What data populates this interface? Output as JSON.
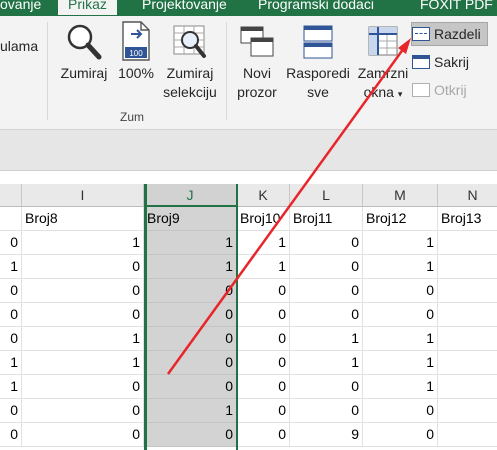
{
  "ribbon": {
    "tabs": [
      {
        "label": "ovanje",
        "active": false
      },
      {
        "label": "Prikaz",
        "active": true
      },
      {
        "label": "Projektovanje",
        "active": false
      },
      {
        "label": "Programski dodaci",
        "active": false
      },
      {
        "label": "FOXIT PDF",
        "active": false
      }
    ],
    "left_partial_label": "ulama",
    "zoom_label": "Zumiraj",
    "zoom_100_label": "100%",
    "zoom_100_icon_text": "100",
    "zoom_selection_label_1": "Zumiraj",
    "zoom_selection_label_2": "selekciju",
    "group_label": "Zum",
    "new_window_label_1": "Novi",
    "new_window_label_2": "prozor",
    "arrange_label_1": "Rasporedi",
    "arrange_label_2": "sve",
    "freeze_label_1": "Zamrzni",
    "freeze_label_2": "okna",
    "split_label": "Razdeli",
    "hide_label": "Sakrij",
    "unhide_label": "Otkrij"
  },
  "columns": [
    {
      "letter": "",
      "header": ""
    },
    {
      "letter": "I",
      "header": "Broj8"
    },
    {
      "letter": "J",
      "header": "Broj9",
      "selected": true
    },
    {
      "letter": "K",
      "header": "Broj10"
    },
    {
      "letter": "L",
      "header": "Broj11"
    },
    {
      "letter": "M",
      "header": "Broj12"
    },
    {
      "letter": "N",
      "header": "Broj13"
    }
  ],
  "rows": [
    [
      "0",
      "1",
      "1",
      "1",
      "0",
      "1",
      ""
    ],
    [
      "1",
      "0",
      "1",
      "1",
      "0",
      "1",
      ""
    ],
    [
      "0",
      "0",
      "0",
      "0",
      "0",
      "0",
      ""
    ],
    [
      "0",
      "0",
      "0",
      "0",
      "0",
      "0",
      ""
    ],
    [
      "0",
      "1",
      "0",
      "0",
      "1",
      "1",
      ""
    ],
    [
      "1",
      "1",
      "0",
      "0",
      "1",
      "1",
      ""
    ],
    [
      "1",
      "0",
      "0",
      "0",
      "0",
      "1",
      ""
    ],
    [
      "0",
      "0",
      "1",
      "0",
      "0",
      "0",
      ""
    ],
    [
      "0",
      "0",
      "0",
      "0",
      "9",
      "0",
      ""
    ]
  ],
  "annotation": {
    "color": "#e8262a",
    "type": "arrow"
  }
}
